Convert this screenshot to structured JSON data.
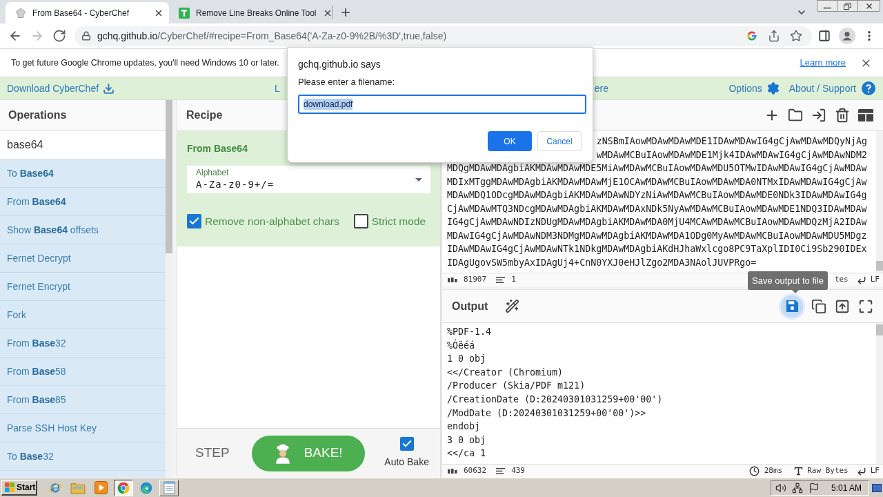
{
  "browser": {
    "tabs": [
      {
        "title": "From Base64 - CyberChef",
        "selected": true
      },
      {
        "title": "Remove Line Breaks Online Tool",
        "selected": false
      }
    ],
    "url_host": "gchq.github.io",
    "url_path": "/CyberChef/#recipe=From_Base64('A-Za-z0-9%2B/%3D',true,false)"
  },
  "infobar": {
    "message": "To get future Google Chrome updates, you'll need Windows 10 or later.",
    "link": "Learn more"
  },
  "banner": {
    "download": "Download CyberChef",
    "fragment_left": "L",
    "fragment_right": "ere",
    "options": "Options",
    "support": "About / Support"
  },
  "operations": {
    "title": "Operations",
    "search": "base64",
    "items": [
      "To **Base64**",
      "From **Base64**",
      "Show **Base64** offsets",
      "Fernet Decrypt",
      "Fernet Encrypt",
      "Fork",
      "From **Base**32",
      "From **Base**58",
      "From **Base**85",
      "Parse SSH Host Key",
      "To **Base**32"
    ]
  },
  "recipe": {
    "title": "Recipe",
    "operation": {
      "name": "From Base64",
      "alphabet_label": "Alphabet",
      "alphabet": "A-Za-z0-9+/=",
      "options": [
        {
          "label": "Remove non-alphabet chars",
          "checked": true
        },
        {
          "label": "Strict mode",
          "checked": false
        }
      ]
    },
    "step": "STEP",
    "bake": "BAKE!",
    "auto_bake": {
      "label": "Auto Bake",
      "checked": true
    }
  },
  "input": {
    "partly_covered_lines": [
      "zNSBmIAowMDAwMDAwMDE1IDAwMDAwIG4gCjAwMDAwMDQyNjAg",
      "wMDAwMCBuIAowMDAwMDE1Mjk4IDAwMDAwIG4gCjAwMDAwNDM2"
    ],
    "lines": [
      "MDQgMDAwMDAgbiAKMDAwMDAwMDE5MiAwMDAwMCBuIAowMDAwMDU5OTMwIDAwMDAwIG4gCjAwMDAw",
      "MDIxMTggMDAwMDAgbiAKMDAwMDAwMjE1OCAwMDAwMCBuIAowMDAwMDA0NTMxIDAwMDAwIG4gCjAw",
      "MDAwMDQ1ODcgMDAwMDAgbiAKMDAwMDAwNDYzNiAwMDAwMCBuIAowMDAwMDE0NDk3IDAwMDAwIG4g",
      "CjAwMDAwMTQ3NDcgMDAwMDAgbiAKMDAwMDAxNDk5NyAwMDAwMCBuIAowMDAwMDE1NDQ3IDAwMDAw",
      "IG4gCjAwMDAwNDIzNDUgMDAwMDAgbiAKMDAwMDA0MjU4MCAwMDAwMCBuIAowMDAwMDQzMjA2IDAw",
      "MDAwIG4gCjAwMDAwNDM3NDMgMDAwMDAgbiAKMDAwMDA1ODg0MyAwMDAwMCBuIAowMDAwMDU5MDgz",
      "IDAwMDAwIG4gCjAwMDAwNTk1NDkgMDAwMDAgbiAKdHJhaWxlcgo8PC9TaXplIDI0Ci9Sb290IDEx",
      "IDAgUgovSW5mbyAxIDAgUj4+CnN0YXJ0eHJlZgo2MDA3NAolJUVPRgo="
    ],
    "status": {
      "length": "81907",
      "lines": "1",
      "encoding_fragment": "tes",
      "eol": "LF"
    }
  },
  "output": {
    "title": "Output",
    "save_highlighted": true,
    "lines": [
      "%PDF-1.4",
      "%Óëéá",
      "1 0 obj",
      "<</Creator (Chromium)",
      "/Producer (Skia/PDF m121)",
      "/CreationDate (D:20240301031259+00'00')",
      "/ModDate (D:20240301031259+00'00')>>",
      "endobj",
      "3 0 obj",
      "<</ca 1"
    ],
    "status": {
      "length": "60632",
      "lines": "439",
      "time": "28ms",
      "encoding": "Raw Bytes",
      "eol": "LF"
    }
  },
  "tooltip": {
    "text": "Save output to file"
  },
  "dialog": {
    "origin": "gchq.github.io says",
    "prompt": "Please enter a filename:",
    "value": "download.pdf",
    "value_selected": true,
    "buttons": [
      {
        "label": "OK",
        "primary": true
      },
      {
        "label": "Cancel",
        "primary": false
      }
    ]
  },
  "taskbar": {
    "start": "Start",
    "apps": [
      {
        "running": false,
        "active": false
      },
      {
        "running": false,
        "active": false
      },
      {
        "running": false,
        "active": false
      },
      {
        "running": true,
        "active": true
      },
      {
        "running": false,
        "active": false
      },
      {
        "running": true,
        "active": false
      }
    ],
    "clock": "5:01 AM"
  }
}
